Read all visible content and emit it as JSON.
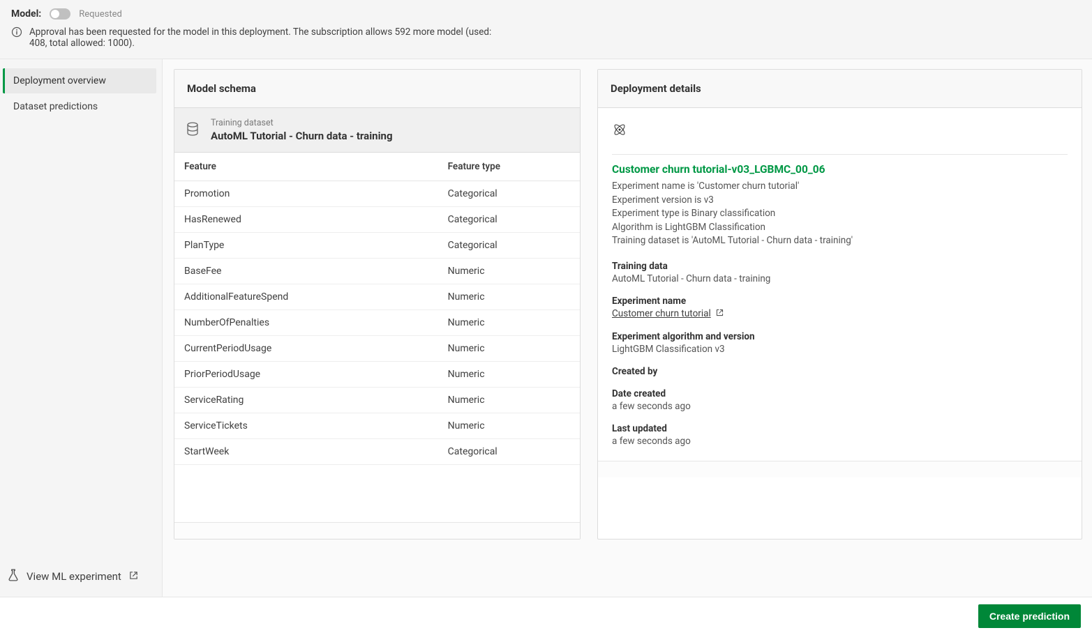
{
  "topbar": {
    "model_label": "Model:",
    "status_text": "Requested",
    "approval_msg": "Approval has been requested for the model in this deployment. The subscription allows 592 more model (used: 408, total allowed: 1000)."
  },
  "sidebar": {
    "items": [
      {
        "label": "Deployment overview",
        "active": true
      },
      {
        "label": "Dataset predictions",
        "active": false
      }
    ],
    "view_experiment_label": "View ML experiment"
  },
  "schema": {
    "header": "Model schema",
    "dataset_caption": "Training dataset",
    "dataset_name": "AutoML Tutorial - Churn data - training",
    "columns": [
      "Feature",
      "Feature type"
    ],
    "rows": [
      {
        "feature": "Promotion",
        "type": "Categorical"
      },
      {
        "feature": "HasRenewed",
        "type": "Categorical"
      },
      {
        "feature": "PlanType",
        "type": "Categorical"
      },
      {
        "feature": "BaseFee",
        "type": "Numeric"
      },
      {
        "feature": "AdditionalFeatureSpend",
        "type": "Numeric"
      },
      {
        "feature": "NumberOfPenalties",
        "type": "Numeric"
      },
      {
        "feature": "CurrentPeriodUsage",
        "type": "Numeric"
      },
      {
        "feature": "PriorPeriodUsage",
        "type": "Numeric"
      },
      {
        "feature": "ServiceRating",
        "type": "Numeric"
      },
      {
        "feature": "ServiceTickets",
        "type": "Numeric"
      },
      {
        "feature": "StartWeek",
        "type": "Categorical"
      }
    ]
  },
  "details": {
    "header": "Deployment details",
    "model_name": "Customer churn tutorial-v03_LGBMC_00_06",
    "lines": [
      "Experiment name is 'Customer churn tutorial'",
      "Experiment version is v3",
      "Experiment type is Binary classification",
      "Algorithm is LightGBM Classification",
      "Training dataset is 'AutoML Tutorial - Churn data - training'"
    ],
    "training_data_label": "Training data",
    "training_data_value": "AutoML Tutorial - Churn data - training",
    "experiment_name_label": "Experiment name",
    "experiment_name_value": "Customer churn tutorial",
    "algo_label": "Experiment algorithm and version",
    "algo_value": "LightGBM Classification v3",
    "created_by_label": "Created by",
    "date_created_label": "Date created",
    "date_created_value": "a few seconds ago",
    "last_updated_label": "Last updated",
    "last_updated_value": "a few seconds ago"
  },
  "footer": {
    "create_prediction_label": "Create prediction"
  }
}
